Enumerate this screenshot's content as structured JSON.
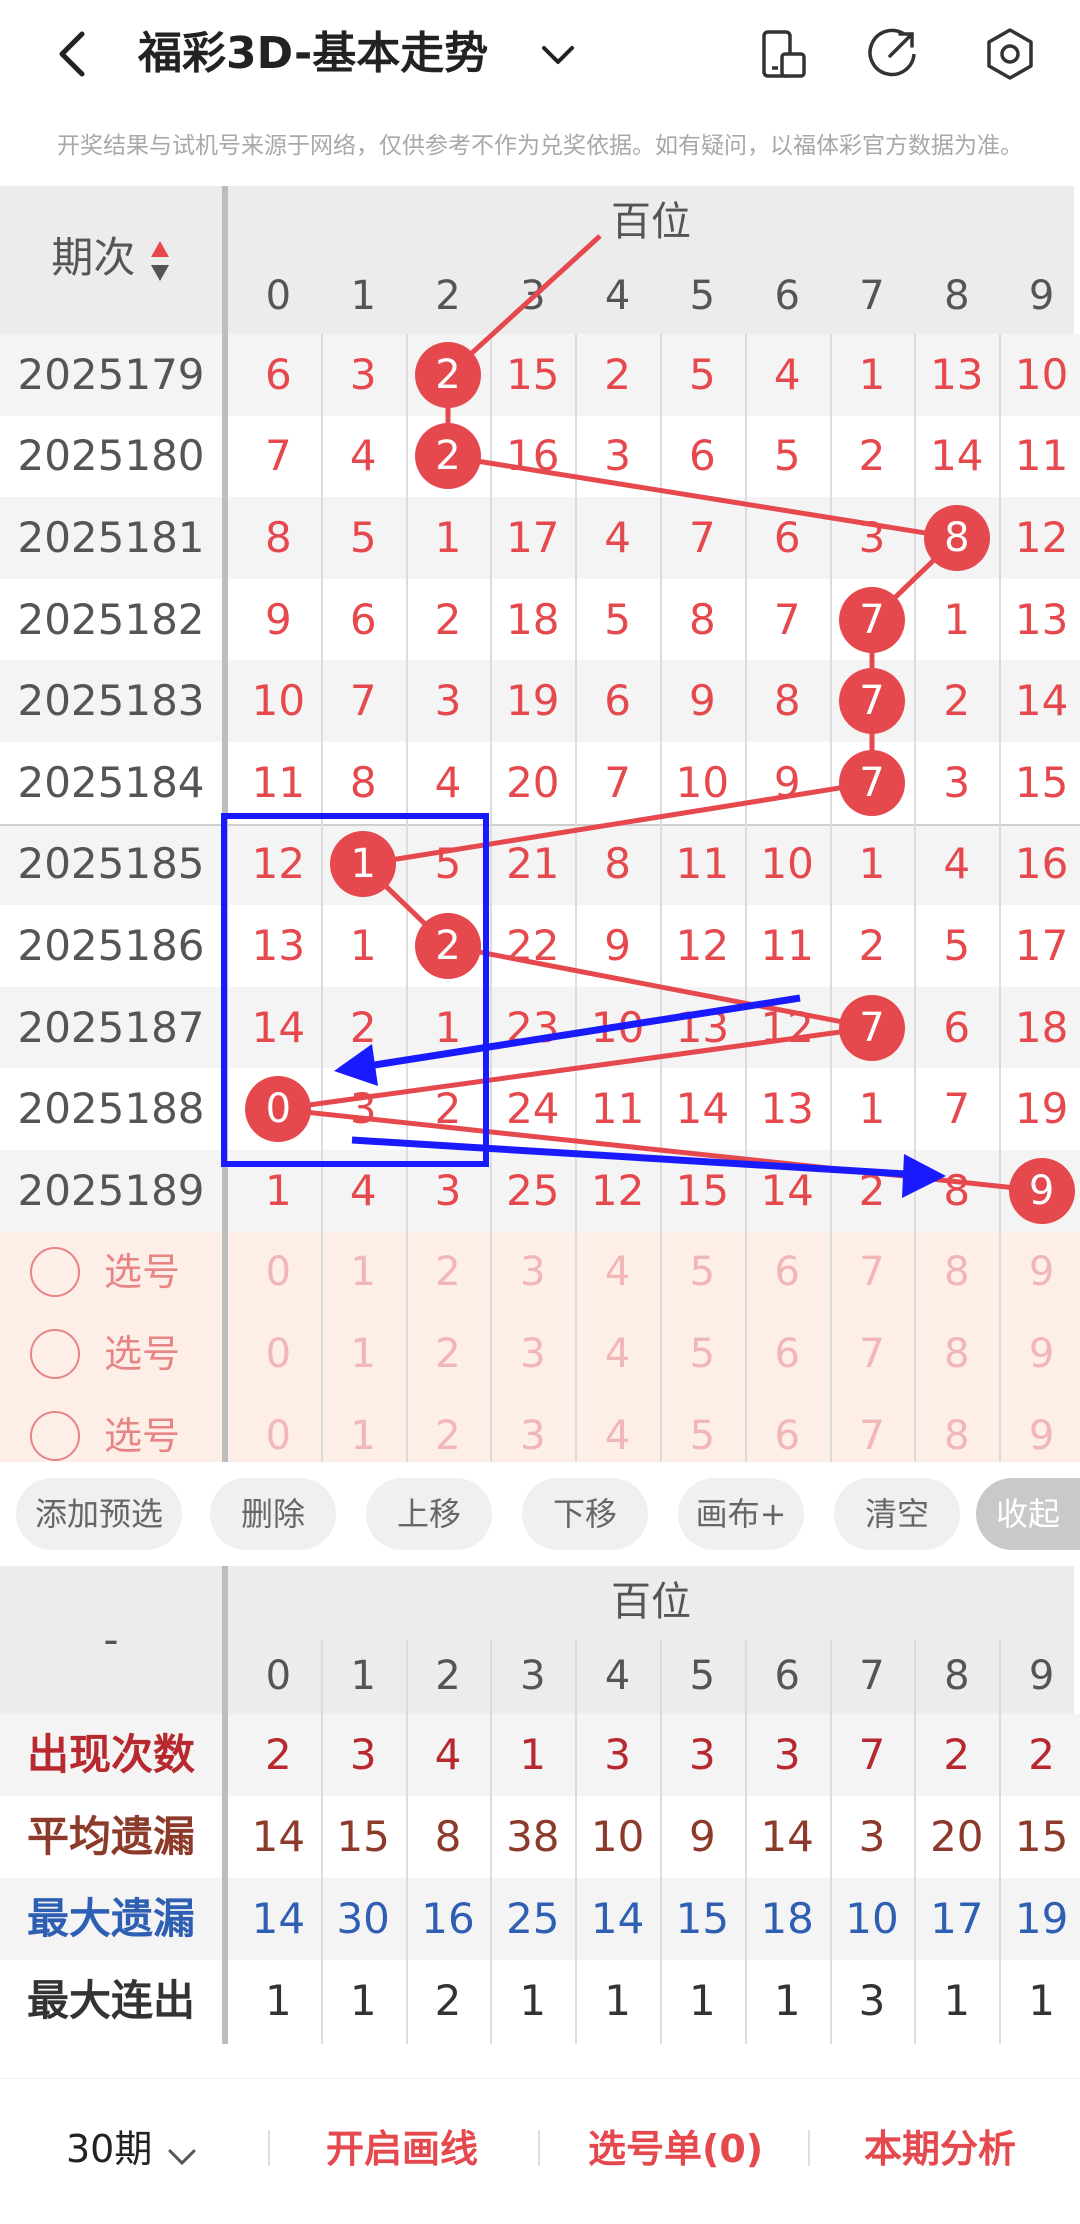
{
  "header": {
    "title": "福彩3D-基本走势",
    "notice": "开奖结果与试机号来源于网络，仅供参考不作为兑奖依据。如有疑问，以福体彩官方数据为准。"
  },
  "grid": {
    "group_title": "百位",
    "period_header": "期次",
    "digits": [
      "0",
      "1",
      "2",
      "3",
      "4",
      "5",
      "6",
      "7",
      "8",
      "9"
    ],
    "rows": [
      {
        "period": "2025179",
        "cells": [
          "6",
          "3",
          "2",
          "15",
          "2",
          "5",
          "4",
          "1",
          "13",
          "10"
        ],
        "hit": 2
      },
      {
        "period": "2025180",
        "cells": [
          "7",
          "4",
          "2",
          "16",
          "3",
          "6",
          "5",
          "2",
          "14",
          "11"
        ],
        "hit": 2
      },
      {
        "period": "2025181",
        "cells": [
          "8",
          "5",
          "1",
          "17",
          "4",
          "7",
          "6",
          "3",
          "8",
          "12"
        ],
        "hit": 8
      },
      {
        "period": "2025182",
        "cells": [
          "9",
          "6",
          "2",
          "18",
          "5",
          "8",
          "7",
          "7",
          "1",
          "13"
        ],
        "hit": 7
      },
      {
        "period": "2025183",
        "cells": [
          "10",
          "7",
          "3",
          "19",
          "6",
          "9",
          "8",
          "7",
          "2",
          "14"
        ],
        "hit": 7
      },
      {
        "period": "2025184",
        "cells": [
          "11",
          "8",
          "4",
          "20",
          "7",
          "10",
          "9",
          "7",
          "3",
          "15"
        ],
        "hit": 7
      },
      {
        "period": "2025185",
        "cells": [
          "12",
          "1",
          "5",
          "21",
          "8",
          "11",
          "10",
          "1",
          "4",
          "16"
        ],
        "hit": 1
      },
      {
        "period": "2025186",
        "cells": [
          "13",
          "1",
          "2",
          "22",
          "9",
          "12",
          "11",
          "2",
          "5",
          "17"
        ],
        "hit": 2
      },
      {
        "period": "2025187",
        "cells": [
          "14",
          "2",
          "1",
          "23",
          "10",
          "13",
          "12",
          "7",
          "6",
          "18"
        ],
        "hit": 7
      },
      {
        "period": "2025188",
        "cells": [
          "0",
          "3",
          "2",
          "24",
          "11",
          "14",
          "13",
          "1",
          "7",
          "19"
        ],
        "hit": 0
      },
      {
        "period": "2025189",
        "cells": [
          "1",
          "4",
          "3",
          "25",
          "12",
          "15",
          "14",
          "2",
          "8",
          "9"
        ],
        "hit": 9
      }
    ],
    "pick_label": "选号",
    "pick_rows": 3
  },
  "toolbar": {
    "buttons": [
      "添加预选",
      "删除",
      "上移",
      "下移",
      "画布+",
      "清空"
    ],
    "collapse": "收起"
  },
  "stats": {
    "group_title": "百位",
    "corner": "-",
    "rows": [
      {
        "label": "出现次数",
        "values": [
          "2",
          "3",
          "4",
          "1",
          "3",
          "3",
          "3",
          "7",
          "2",
          "2"
        ],
        "color": "#b8282f"
      },
      {
        "label": "平均遗漏",
        "values": [
          "14",
          "15",
          "8",
          "38",
          "10",
          "9",
          "14",
          "3",
          "20",
          "15"
        ],
        "color": "#8c3a2a"
      },
      {
        "label": "最大遗漏",
        "values": [
          "14",
          "30",
          "16",
          "25",
          "14",
          "15",
          "18",
          "10",
          "17",
          "19"
        ],
        "color": "#2f5fb3"
      },
      {
        "label": "最大连出",
        "values": [
          "1",
          "1",
          "2",
          "1",
          "1",
          "1",
          "1",
          "3",
          "1",
          "1"
        ],
        "color": "#333333"
      }
    ]
  },
  "bottom": {
    "periods": "30期",
    "draw_line": "开启画线",
    "pick_list": "选号单(0)",
    "analysis": "本期分析"
  },
  "colors": {
    "accent_red": "#e5484d",
    "annotation_blue": "#1a1aff",
    "pick_bg": "#fdeee8"
  }
}
